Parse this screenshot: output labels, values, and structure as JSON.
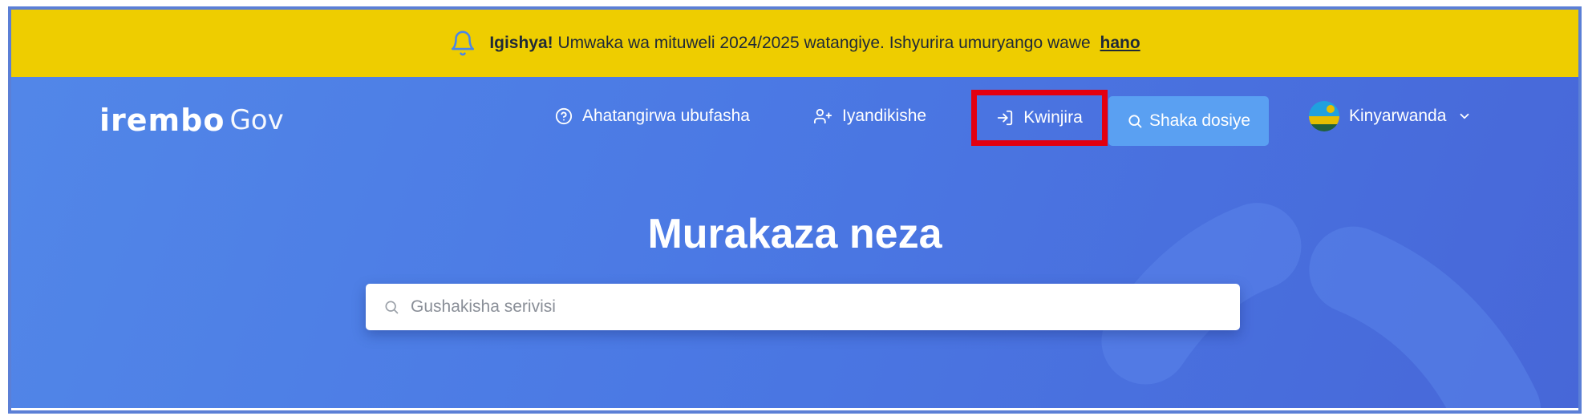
{
  "banner": {
    "icon": "bell-icon",
    "bold": "Igishya!",
    "message": "Umwaka wa mituweli 2024/2025 watangiye. Ishyurira umuryango wawe",
    "link": "hano",
    "background": "#eecd00"
  },
  "header": {
    "logo": {
      "wordmark": "irembo",
      "suffix": "Gov"
    },
    "nav": {
      "help": {
        "label": "Ahatangirwa ubufasha",
        "icon": "help-circle-icon"
      },
      "register": {
        "label": "Iyandikishe",
        "icon": "user-plus-icon"
      },
      "login": {
        "label": "Kwinjira",
        "icon": "login-icon"
      },
      "track": {
        "label": "Shaka dosiye",
        "icon": "search-icon"
      },
      "language": {
        "label": "Kinyarwanda",
        "icon": "rwanda-flag-icon"
      }
    }
  },
  "hero": {
    "title": "Murakaza neza",
    "search": {
      "placeholder": "Gushakisha serivisi",
      "value": ""
    }
  },
  "colors": {
    "brand_blue": "#4b79e4",
    "accent_button": "#5aa0f2",
    "highlight_box": "#e3000f"
  }
}
